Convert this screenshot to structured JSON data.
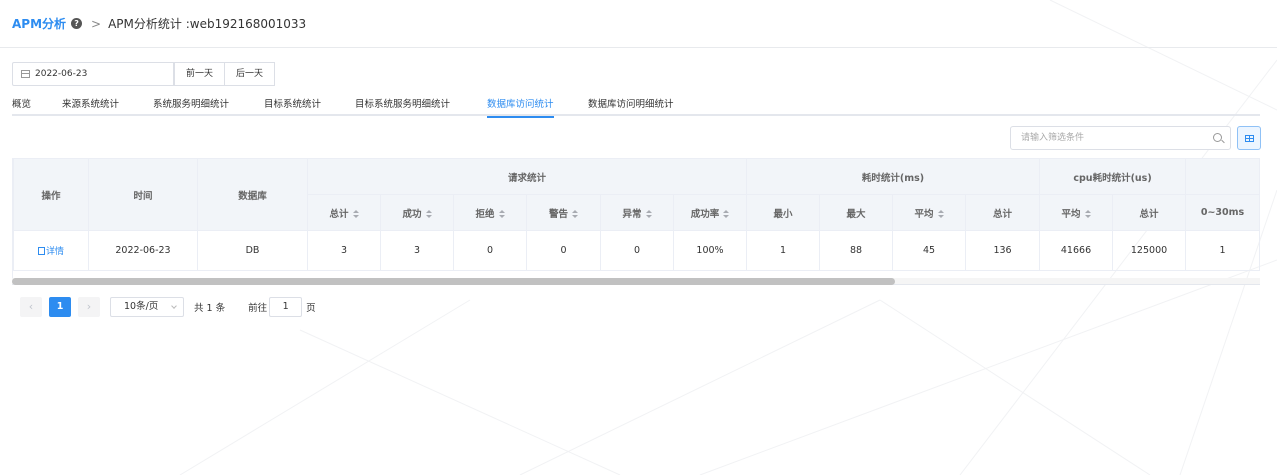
{
  "header": {
    "brand": "APM分析",
    "breadcrumb_sep": ">",
    "title": "APM分析统计 :web192168001033"
  },
  "date": {
    "value": "2022-06-23",
    "prev_label": "前一天",
    "next_label": "后一天"
  },
  "tabs": [
    {
      "label": "概览",
      "active": false
    },
    {
      "label": "来源系统统计",
      "active": false
    },
    {
      "label": "系统服务明细统计",
      "active": false
    },
    {
      "label": "目标系统统计",
      "active": false
    },
    {
      "label": "目标系统服务明细统计",
      "active": false
    },
    {
      "label": "数据库访问统计",
      "active": true
    },
    {
      "label": "数据库访问明细统计",
      "active": false
    }
  ],
  "filter": {
    "placeholder": "请输入筛选条件"
  },
  "table": {
    "headers": {
      "action": "操作",
      "time": "时间",
      "database": "数据库",
      "request_group": "请求统计",
      "cost_group": "耗时统计(ms)",
      "cpu_group": "cpu耗时统计(us)",
      "req_total": "总计",
      "req_success": "成功",
      "req_reject": "拒绝",
      "req_warn": "警告",
      "req_error": "异常",
      "req_rate": "成功率",
      "cost_min": "最小",
      "cost_max": "最大",
      "cost_avg": "平均",
      "cost_total": "总计",
      "cpu_avg": "平均",
      "cpu_total": "总计",
      "dist_0_30": "0~30ms"
    },
    "rows": [
      {
        "action": "详情",
        "time": "2022-06-23",
        "database": "DB",
        "req_total": "3",
        "req_success": "3",
        "req_reject": "0",
        "req_warn": "0",
        "req_error": "0",
        "req_rate": "100%",
        "cost_min": "1",
        "cost_max": "88",
        "cost_avg": "45",
        "cost_total": "136",
        "cpu_avg": "41666",
        "cpu_total": "125000",
        "dist_0_30": "1"
      }
    ]
  },
  "pagination": {
    "current_page": "1",
    "page_size": "10条/页",
    "total": "共 1 条",
    "goto_label": "前往",
    "goto_value": "1",
    "page_suffix": "页",
    "prev_icon": "‹",
    "next_icon": "›"
  }
}
